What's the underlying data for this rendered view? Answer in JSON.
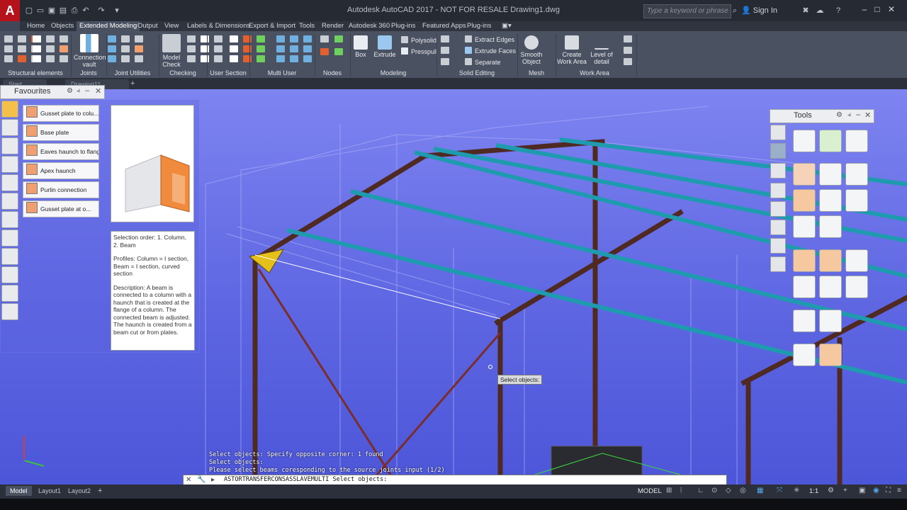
{
  "app": {
    "title": "Autodesk AutoCAD 2017 - NOT FOR RESALE    Drawing1.dwg",
    "logo": "A",
    "search_placeholder": "Type a keyword or phrase",
    "signin": "Sign In"
  },
  "ribbon_tabs": [
    "Home",
    "Objects",
    "Extended Modeling",
    "Output",
    "View",
    "Labels & Dimensions",
    "Export & Import",
    "Tools",
    "Render",
    "Autodesk 360",
    "Plug-ins",
    "Featured Apps",
    "Plug-ins"
  ],
  "ribbon": {
    "panels": [
      "Structural elements",
      "Joints",
      "Joint Utilities",
      "Checking",
      "User Section",
      "Multi User",
      "Nodes",
      "Modeling",
      "Solid Editing",
      "Mesh",
      "Work Area"
    ],
    "connection_vault": "Connection vault",
    "model_check": "Model Check",
    "box": "Box",
    "extrude": "Extrude",
    "polysolid": "Polysolid",
    "presspull": "Presspull",
    "extract_edges": "Extract Edges",
    "extrude_faces": "Extrude Faces",
    "separate": "Separate",
    "smooth_object": "Smooth Object",
    "create_work_area": "Create Work Area",
    "level_of_detail": "Level of detail"
  },
  "file_tabs": [
    "Start",
    "Drawing1*"
  ],
  "favourites": {
    "title": "Favourites",
    "items": [
      "Gusset plate to colu...",
      "Base plate",
      "Eaves haunch to flange",
      "Apex haunch",
      "Purlin connection",
      "Gusset plate at o..."
    ],
    "description": [
      "Selection order: 1. Column, 2. Beam",
      "Profiles: Column = I section, Beam = I section, curved section",
      "Description: A beam is connected to a column with a haunch that is created at the flange of a column. The connected beam is adjusted. The haunch is created from a beam cut or from plates."
    ]
  },
  "tools": {
    "title": "Tools"
  },
  "command": {
    "history": [
      "Select objects: Specify opposite corner: 1 found",
      "Select objects:",
      "Please select beams coresponding to the source joints input (1/2)"
    ],
    "current": "ASTORTRANSFERCONSASSLAVEMULTI Select objects:",
    "tooltip": "Select objects:"
  },
  "layouts": [
    "Model",
    "Layout1",
    "Layout2"
  ],
  "status": {
    "model": "MODEL",
    "scale": "1:1"
  },
  "colors": {
    "viewport_top": "#7e84f0",
    "viewport_bottom": "#4c56d8",
    "steel": "#4e2a22",
    "purlin": "#1f9bb0"
  }
}
